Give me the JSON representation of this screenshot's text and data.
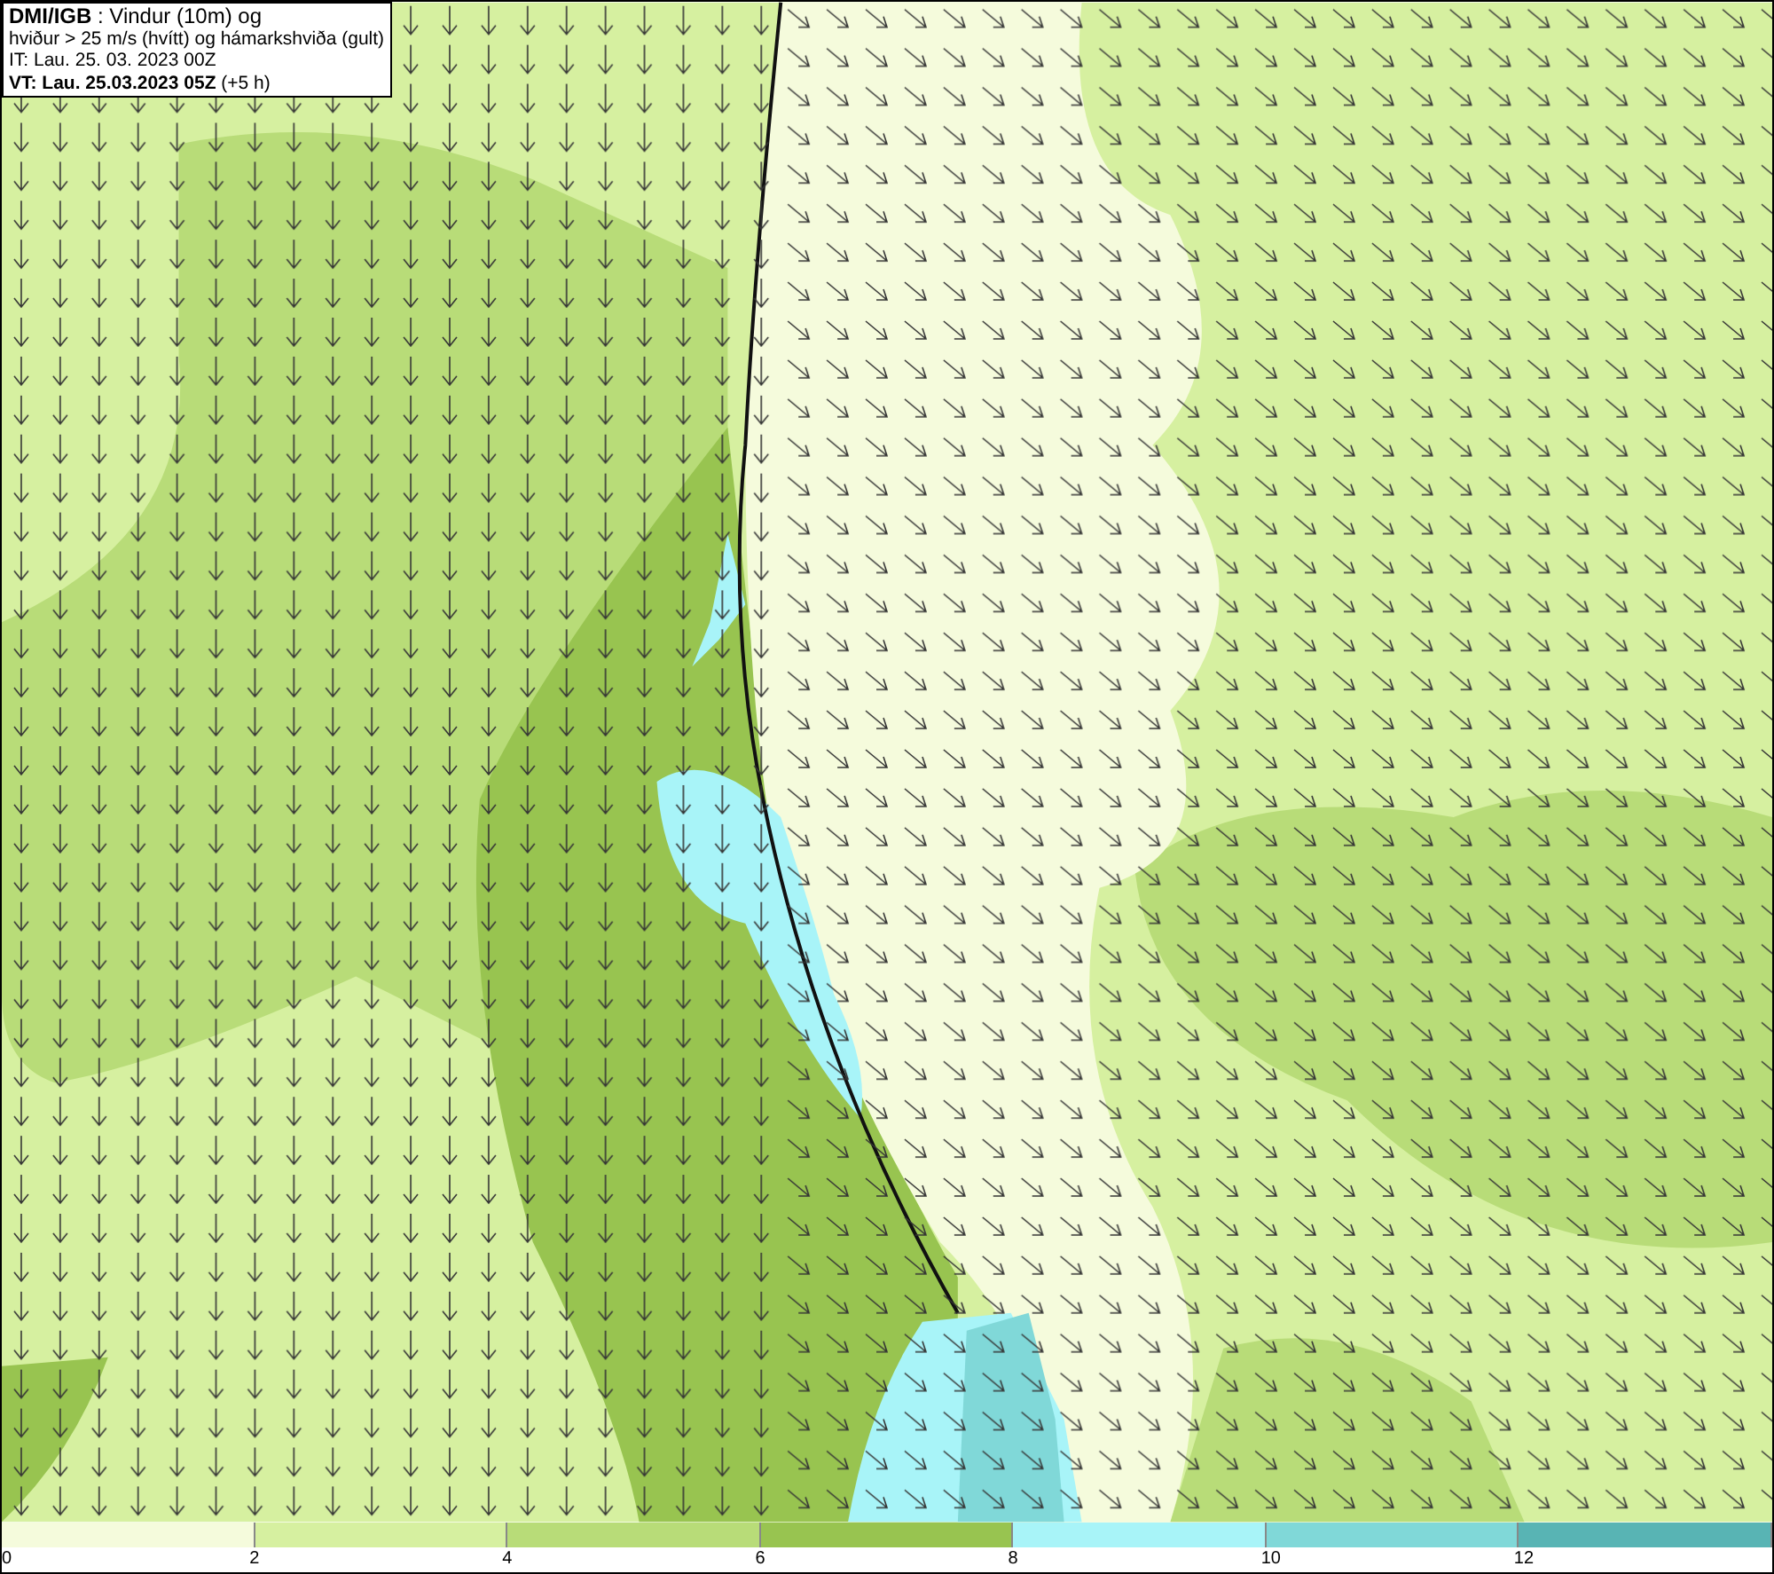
{
  "legend": {
    "lines": [
      "**DMI/IGB** : Vindur (10m) og",
      "hviður > 25 m/s (hvítt) og hámarkshviða (gult)",
      "IT: Lau. 25. 03. 2023 00Z",
      "**VT: Lau. 25.03.2023 05Z** (+5 h)"
    ]
  },
  "colorbar": [
    {
      "label": "0",
      "color": "#f5fbdc"
    },
    {
      "label": "2",
      "color": "#d6f0a0"
    },
    {
      "label": "4",
      "color": "#b8dc78"
    },
    {
      "label": "6",
      "color": "#98c450"
    },
    {
      "label": "8",
      "color": "#a8f4f8"
    },
    {
      "label": "10",
      "color": "#80d8d8"
    },
    {
      "label": "12",
      "color": "#58b4b4"
    }
  ]
}
